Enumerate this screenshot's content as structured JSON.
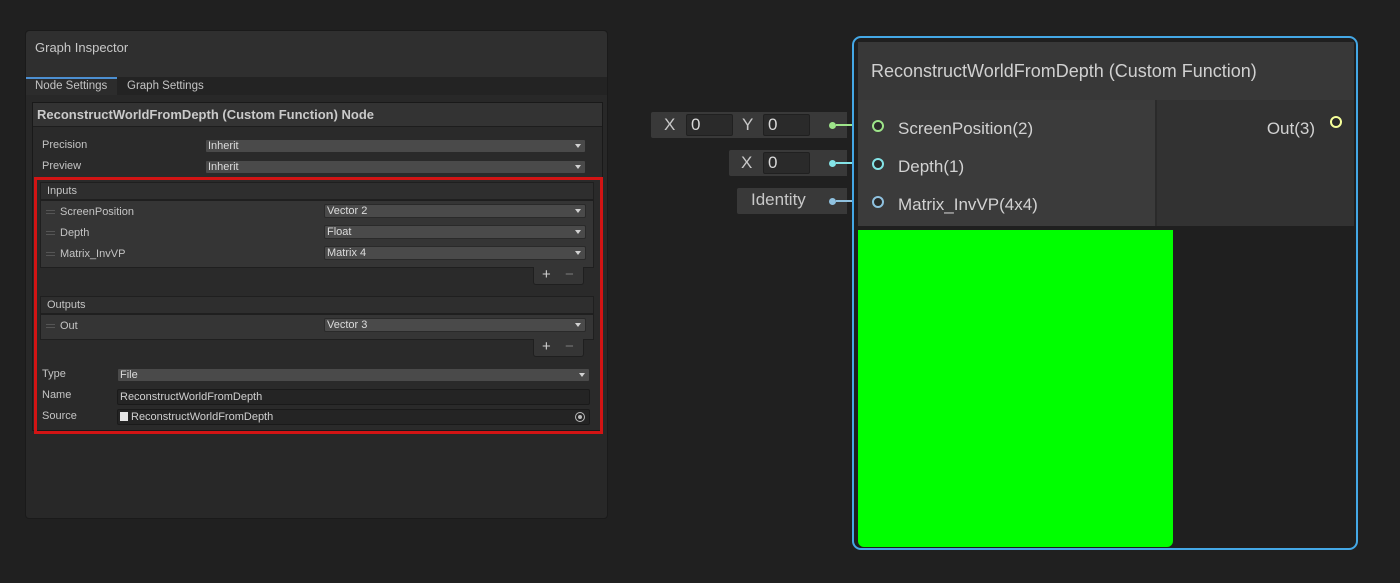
{
  "inspector": {
    "title": "Graph Inspector",
    "tabs": [
      {
        "label": "Node Settings"
      },
      {
        "label": "Graph Settings"
      }
    ],
    "node_header": "ReconstructWorldFromDepth (Custom Function) Node",
    "precision": {
      "label": "Precision",
      "value": "Inherit"
    },
    "preview": {
      "label": "Preview",
      "value": "Inherit"
    },
    "inputs": {
      "header": "Inputs",
      "rows": [
        {
          "name": "ScreenPosition",
          "type": "Vector 2"
        },
        {
          "name": "Depth",
          "type": "Float"
        },
        {
          "name": "Matrix_InvVP",
          "type": "Matrix 4"
        }
      ]
    },
    "outputs": {
      "header": "Outputs",
      "rows": [
        {
          "name": "Out",
          "type": "Vector 3"
        }
      ]
    },
    "add_symbol": "+",
    "remove_symbol": "−",
    "type_field": {
      "label": "Type",
      "value": "File"
    },
    "name_field": {
      "label": "Name",
      "value": "ReconstructWorldFromDepth"
    },
    "source_field": {
      "label": "Source",
      "value": "ReconstructWorldFromDepth"
    }
  },
  "graph": {
    "screenpos_inline": {
      "x_label": "X",
      "x_value": "0",
      "y_label": "Y",
      "y_value": "0"
    },
    "depth_inline": {
      "x_label": "X",
      "x_value": "0"
    },
    "matrix_inline": {
      "value": "Identity"
    },
    "node": {
      "title": "ReconstructWorldFromDepth (Custom Function)",
      "inputs": [
        {
          "label": "ScreenPosition(2)",
          "color": "#9ee58a"
        },
        {
          "label": "Depth(1)",
          "color": "#84e4e7"
        },
        {
          "label": "Matrix_InvVP(4x4)",
          "color": "#8fc1df"
        }
      ],
      "outputs": [
        {
          "label": "Out(3)",
          "color": "#f6ff9a"
        }
      ],
      "preview_color": "#00ff00",
      "selection_color": "#44a8e6"
    }
  }
}
